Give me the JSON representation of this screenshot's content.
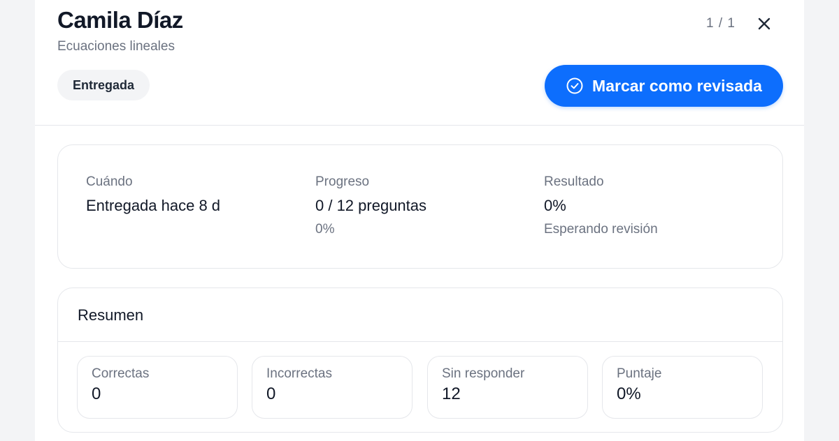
{
  "header": {
    "student_name": "Camila Díaz",
    "assignment": "Ecuaciones lineales",
    "pager": "1 / 1",
    "status_badge": "Entregada",
    "mark_reviewed_label": "Marcar como revisada",
    "accent_color": "#0d6efd",
    "icons": {
      "close": "close-icon",
      "check": "check-circle-icon"
    }
  },
  "info": {
    "when": {
      "label": "Cuándo",
      "value": "Entregada hace 8 d"
    },
    "progress": {
      "label": "Progreso",
      "value": "0 / 12 preguntas",
      "sub": "0%"
    },
    "result": {
      "label": "Resultado",
      "value": "0%",
      "sub": "Esperando revisión"
    }
  },
  "summary": {
    "title": "Resumen",
    "stats": [
      {
        "label": "Correctas",
        "value": "0"
      },
      {
        "label": "Incorrectas",
        "value": "0"
      },
      {
        "label": "Sin responder",
        "value": "12"
      },
      {
        "label": "Puntaje",
        "value": "0%"
      }
    ]
  }
}
